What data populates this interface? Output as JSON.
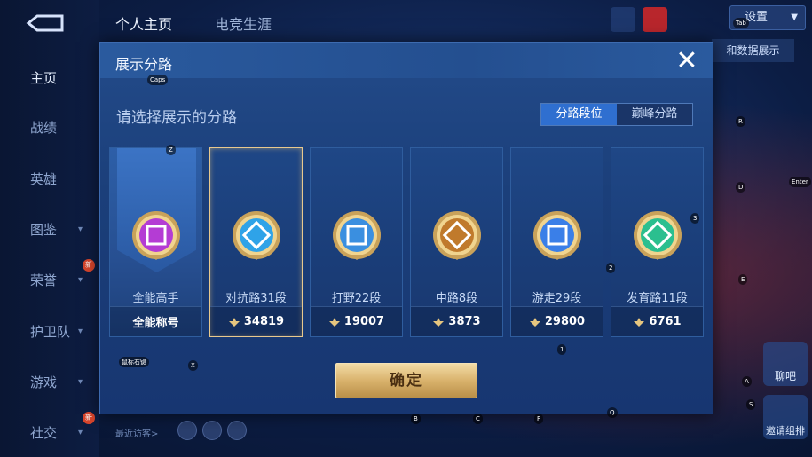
{
  "nav": {
    "items": [
      {
        "label": "主页",
        "active": true,
        "chevron": false
      },
      {
        "label": "战绩",
        "active": false,
        "chevron": false
      },
      {
        "label": "英雄",
        "active": false,
        "chevron": false
      },
      {
        "label": "图鉴",
        "active": false,
        "chevron": true
      },
      {
        "label": "荣誉",
        "active": false,
        "chevron": true,
        "badge": "新"
      },
      {
        "label": "护卫队",
        "active": false,
        "chevron": true
      },
      {
        "label": "游戏",
        "active": false,
        "chevron": true
      },
      {
        "label": "社交",
        "active": false,
        "chevron": true,
        "badge": "新"
      }
    ]
  },
  "header": {
    "tabs": [
      "个人主页",
      "电竞生涯"
    ],
    "settings_label": "设置",
    "data_show_label": "和数据展示"
  },
  "bottom": {
    "recent_visitors": "最近访客>"
  },
  "right_buttons": [
    "聊吧",
    "邀请组排"
  ],
  "modal": {
    "title": "展示分路",
    "prompt": "请选择展示的分路",
    "segment": {
      "options": [
        "分路段位",
        "巅峰分路"
      ],
      "selected": 0
    },
    "confirm_label": "确定",
    "cards": [
      {
        "name": "全能高手",
        "bottom": "全能称号",
        "emblem": "versatile-emblem-icon",
        "color": "#b43cd4",
        "selected": false,
        "is_banner": true
      },
      {
        "name": "对抗路31段",
        "score": "34819",
        "emblem": "clash-lane-emblem-icon",
        "color": "#2fa3e8",
        "selected": true
      },
      {
        "name": "打野22段",
        "score": "19007",
        "emblem": "jungle-emblem-icon",
        "color": "#3a8fe0",
        "selected": false
      },
      {
        "name": "中路8段",
        "score": "3873",
        "emblem": "mid-lane-emblem-icon",
        "color": "#c07a2c",
        "selected": false
      },
      {
        "name": "游走29段",
        "score": "29800",
        "emblem": "roam-emblem-icon",
        "color": "#3a7fe8",
        "selected": false
      },
      {
        "name": "发育路11段",
        "score": "6761",
        "emblem": "farm-lane-emblem-icon",
        "color": "#2bbf8f",
        "selected": false
      }
    ]
  },
  "overlay_hints": [
    "Z",
    "X",
    "C",
    "B",
    "F",
    "1",
    "2",
    "3",
    "Q",
    "A",
    "S",
    "D",
    "E",
    "R",
    "Caps",
    "Enter",
    "Tab",
    "鼠标右键"
  ],
  "colors": {
    "accent_blue": "#2f6fd0",
    "gold": "#d9b26c",
    "panel": "#1b3f7a"
  }
}
